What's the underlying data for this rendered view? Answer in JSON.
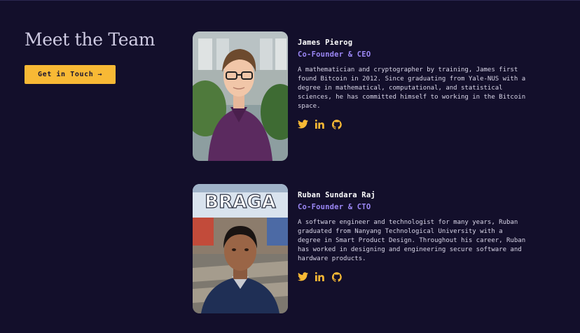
{
  "section": {
    "title": "Meet the Team",
    "cta_label": "Get in Touch",
    "cta_arrow": "→"
  },
  "team": [
    {
      "name": "James Pierog",
      "role": "Co-Founder & CEO",
      "bio": "A mathematician and cryptographer by training, James first\nfound Bitcoin in 2012. Since graduating from Yale-NUS with a\ndegree in mathematical, computational, and statistical\nsciences, he has committed himself to working in the Bitcoin\nspace.",
      "socials": [
        "twitter-icon",
        "linkedin-icon",
        "github-icon"
      ]
    },
    {
      "name": "Ruban Sundara Raj",
      "role": "Co-Founder & CTO",
      "bio": "A software engineer and technologist for many years, Ruban\ngraduated from Nanyang Technological University with a\ndegree in Smart Product Design. Throughout his career, Ruban\nhas worked in designing and engineering secure software and\nhardware products.",
      "photo_sign": "BRAGA",
      "socials": [
        "twitter-icon",
        "linkedin-icon",
        "github-icon"
      ]
    }
  ],
  "colors": {
    "background": "#130f2b",
    "accent": "#f8b935",
    "role": "#9b87f5"
  }
}
